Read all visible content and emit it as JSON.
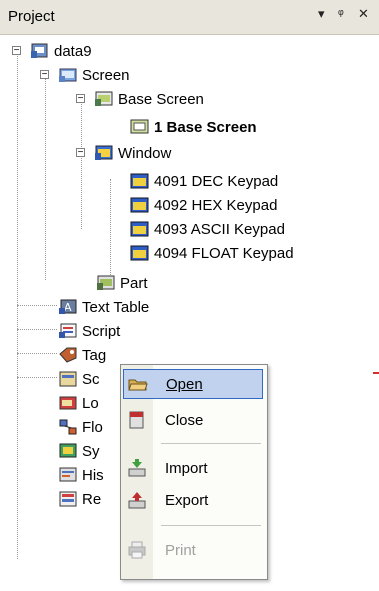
{
  "panel": {
    "title": "Project",
    "controls": [
      "▾",
      "ᵠ",
      "✕"
    ]
  },
  "tree": {
    "root": "data9",
    "screen": "Screen",
    "base_screen": "Base Screen",
    "base_screen_1": "1 Base Screen",
    "window": "Window",
    "windows": [
      "4091 DEC Keypad",
      "4092 HEX Keypad",
      "4093 ASCII Keypad",
      "4094 FLOAT Keypad"
    ],
    "part": "Part",
    "text_table": "Text Table",
    "script": "Script",
    "tag": "Tag",
    "partial": [
      "Sc",
      "Lo",
      "Flo",
      "Sy",
      "His",
      "Re"
    ]
  },
  "menu": {
    "open": "Open",
    "close": "Close",
    "import": "Import",
    "export": "Export",
    "print": "Print"
  }
}
